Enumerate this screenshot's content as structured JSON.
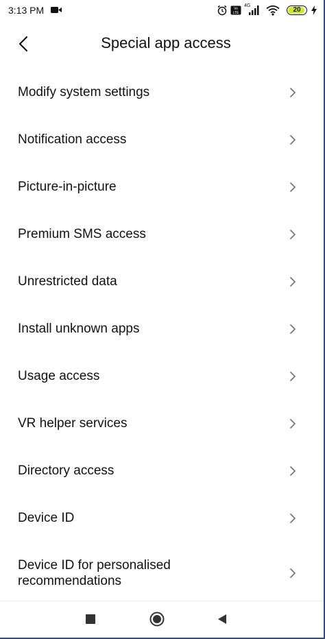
{
  "status_bar": {
    "time": "3:13 PM",
    "network_type": "4G",
    "battery_level": "20",
    "icons": [
      "video-icon",
      "alarm-icon",
      "volte-icon",
      "signal-icon",
      "wifi-icon",
      "battery-icon",
      "charging-bolt-icon"
    ]
  },
  "header": {
    "title": "Special app access",
    "back_icon": "chevron-left-icon"
  },
  "list": {
    "items": [
      {
        "label": "Modify system settings"
      },
      {
        "label": "Notification access"
      },
      {
        "label": "Picture-in-picture"
      },
      {
        "label": "Premium SMS access"
      },
      {
        "label": "Unrestricted data"
      },
      {
        "label": "Install unknown apps"
      },
      {
        "label": "Usage access"
      },
      {
        "label": "VR helper services"
      },
      {
        "label": "Directory access"
      },
      {
        "label": "Device ID"
      },
      {
        "label": "Device ID for personalised recommendations"
      }
    ],
    "trailing_icon": "chevron-right-icon"
  },
  "nav_bar": {
    "buttons": [
      "recents-button",
      "home-button",
      "back-button"
    ]
  },
  "colors": {
    "background": "#ffffff",
    "text": "#111111",
    "chevron": "#777777",
    "battery_fill": "#cfe830",
    "frame": "#2f4c86"
  }
}
